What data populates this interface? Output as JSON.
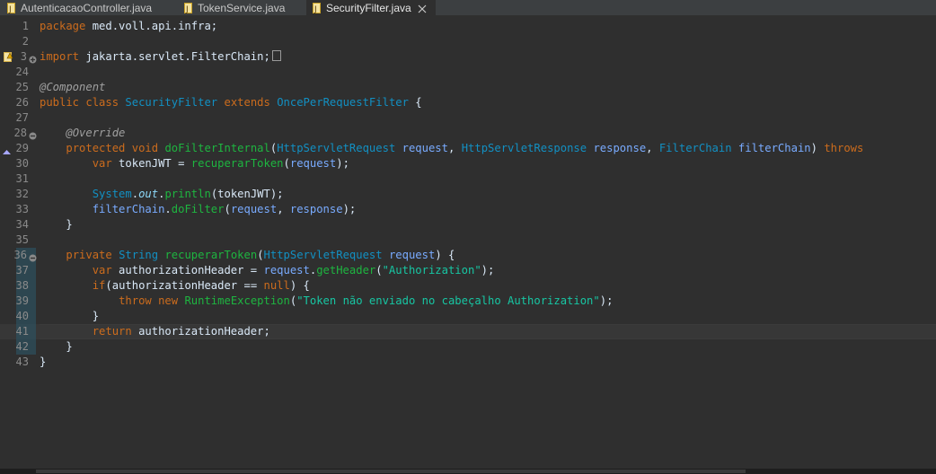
{
  "tabs": [
    {
      "label": "AutenticacaoController.java",
      "active": false
    },
    {
      "label": "TokenService.java",
      "active": false
    },
    {
      "label": "SecurityFilter.java",
      "active": true
    }
  ],
  "icons": {
    "tab_file": "java-file-icon",
    "close": "close-icon",
    "fold_expanded": "fold-minus-icon",
    "fold_collapsed": "fold-plus-icon",
    "warning": "warning-icon",
    "override": "override-triangle-icon"
  },
  "colors": {
    "keyword": "#cc6c1d",
    "type": "#1290c3",
    "method": "#1eb540",
    "parameter": "#79abff",
    "string": "#17c6a3",
    "annotation": "#a0a0a0",
    "background": "#2f2f2f"
  },
  "lines": [
    {
      "no": "1",
      "tokens": [
        [
          "kw",
          "package"
        ],
        [
          "pl",
          " med.voll.api.infra;"
        ]
      ]
    },
    {
      "no": "2",
      "tokens": []
    },
    {
      "no": "3",
      "fold": "plus",
      "marker": "warning",
      "tokens": [
        [
          "kw",
          "import"
        ],
        [
          "pl",
          " jakarta.servlet.FilterChain;"
        ],
        [
          "box",
          ""
        ]
      ]
    },
    {
      "no": "24",
      "tokens": []
    },
    {
      "no": "25",
      "tokens": [
        [
          "ann",
          "@Component"
        ]
      ]
    },
    {
      "no": "26",
      "tokens": [
        [
          "kw",
          "public"
        ],
        [
          "pl",
          " "
        ],
        [
          "kw",
          "class"
        ],
        [
          "pl",
          " "
        ],
        [
          "ty",
          "SecurityFilter"
        ],
        [
          "pl",
          " "
        ],
        [
          "kw",
          "extends"
        ],
        [
          "pl",
          " "
        ],
        [
          "ty",
          "OncePerRequestFilter"
        ],
        [
          "pl",
          " {"
        ]
      ]
    },
    {
      "no": "27",
      "tokens": []
    },
    {
      "no": "28",
      "fold": "minus",
      "tokens": [
        [
          "pl",
          "    "
        ],
        [
          "ann",
          "@Override"
        ]
      ]
    },
    {
      "no": "29",
      "marker": "override",
      "tokens": [
        [
          "pl",
          "    "
        ],
        [
          "kw",
          "protected"
        ],
        [
          "pl",
          " "
        ],
        [
          "kw",
          "void"
        ],
        [
          "pl",
          " "
        ],
        [
          "fn",
          "doFilterInternal"
        ],
        [
          "pl",
          "("
        ],
        [
          "ty",
          "HttpServletRequest"
        ],
        [
          "pl",
          " "
        ],
        [
          "par",
          "request"
        ],
        [
          "pl",
          ", "
        ],
        [
          "ty",
          "HttpServletResponse"
        ],
        [
          "pl",
          " "
        ],
        [
          "par",
          "response"
        ],
        [
          "pl",
          ", "
        ],
        [
          "ty",
          "FilterChain"
        ],
        [
          "pl",
          " "
        ],
        [
          "par",
          "filterChain"
        ],
        [
          "pl",
          ") "
        ],
        [
          "kw",
          "throws"
        ]
      ]
    },
    {
      "no": "30",
      "tokens": [
        [
          "pl",
          "        "
        ],
        [
          "kw",
          "var"
        ],
        [
          "pl",
          " tokenJWT = "
        ],
        [
          "fn",
          "recuperarToken"
        ],
        [
          "pl",
          "("
        ],
        [
          "par",
          "request"
        ],
        [
          "pl",
          ");"
        ]
      ]
    },
    {
      "no": "31",
      "tokens": []
    },
    {
      "no": "32",
      "tokens": [
        [
          "pl",
          "        "
        ],
        [
          "ty",
          "System"
        ],
        [
          "pl",
          "."
        ],
        [
          "fld",
          "out"
        ],
        [
          "pl",
          "."
        ],
        [
          "fn",
          "println"
        ],
        [
          "pl",
          "(tokenJWT);"
        ]
      ]
    },
    {
      "no": "33",
      "tokens": [
        [
          "pl",
          "        "
        ],
        [
          "par",
          "filterChain"
        ],
        [
          "pl",
          "."
        ],
        [
          "fn",
          "doFilter"
        ],
        [
          "pl",
          "("
        ],
        [
          "par",
          "request"
        ],
        [
          "pl",
          ", "
        ],
        [
          "par",
          "response"
        ],
        [
          "pl",
          ");"
        ]
      ]
    },
    {
      "no": "34",
      "tokens": [
        [
          "pl",
          "    }"
        ]
      ]
    },
    {
      "no": "35",
      "tokens": []
    },
    {
      "no": "36",
      "fold": "minus",
      "scope": true,
      "tokens": [
        [
          "pl",
          "    "
        ],
        [
          "kw",
          "private"
        ],
        [
          "pl",
          " "
        ],
        [
          "ty",
          "String"
        ],
        [
          "pl",
          " "
        ],
        [
          "fn",
          "recuperarToken"
        ],
        [
          "pl",
          "("
        ],
        [
          "ty",
          "HttpServletRequest"
        ],
        [
          "pl",
          " "
        ],
        [
          "par",
          "request"
        ],
        [
          "pl",
          ") {"
        ]
      ]
    },
    {
      "no": "37",
      "scope": true,
      "tokens": [
        [
          "pl",
          "        "
        ],
        [
          "kw",
          "var"
        ],
        [
          "pl",
          " authorizationHeader = "
        ],
        [
          "par",
          "request"
        ],
        [
          "pl",
          "."
        ],
        [
          "fn",
          "getHeader"
        ],
        [
          "pl",
          "("
        ],
        [
          "str",
          "\"Authorization\""
        ],
        [
          "pl",
          ");"
        ]
      ]
    },
    {
      "no": "38",
      "scope": true,
      "tokens": [
        [
          "pl",
          "        "
        ],
        [
          "kw",
          "if"
        ],
        [
          "pl",
          "(authorizationHeader == "
        ],
        [
          "kw",
          "null"
        ],
        [
          "pl",
          ") {"
        ]
      ]
    },
    {
      "no": "39",
      "scope": true,
      "tokens": [
        [
          "pl",
          "            "
        ],
        [
          "kw",
          "throw"
        ],
        [
          "pl",
          " "
        ],
        [
          "kw",
          "new"
        ],
        [
          "pl",
          " "
        ],
        [
          "fn",
          "RuntimeException"
        ],
        [
          "pl",
          "("
        ],
        [
          "str",
          "\"Token não enviado no cabeçalho Authorization\""
        ],
        [
          "pl",
          ");"
        ]
      ]
    },
    {
      "no": "40",
      "scope": true,
      "tokens": [
        [
          "pl",
          "        }"
        ]
      ]
    },
    {
      "no": "41",
      "scope": true,
      "current": true,
      "tokens": [
        [
          "pl",
          "        "
        ],
        [
          "kw",
          "return"
        ],
        [
          "pl",
          " authorizationHeader;"
        ]
      ]
    },
    {
      "no": "42",
      "scope": true,
      "tokens": [
        [
          "pl",
          "    }"
        ]
      ]
    },
    {
      "no": "43",
      "tokens": [
        [
          "pl",
          "}"
        ]
      ]
    }
  ]
}
